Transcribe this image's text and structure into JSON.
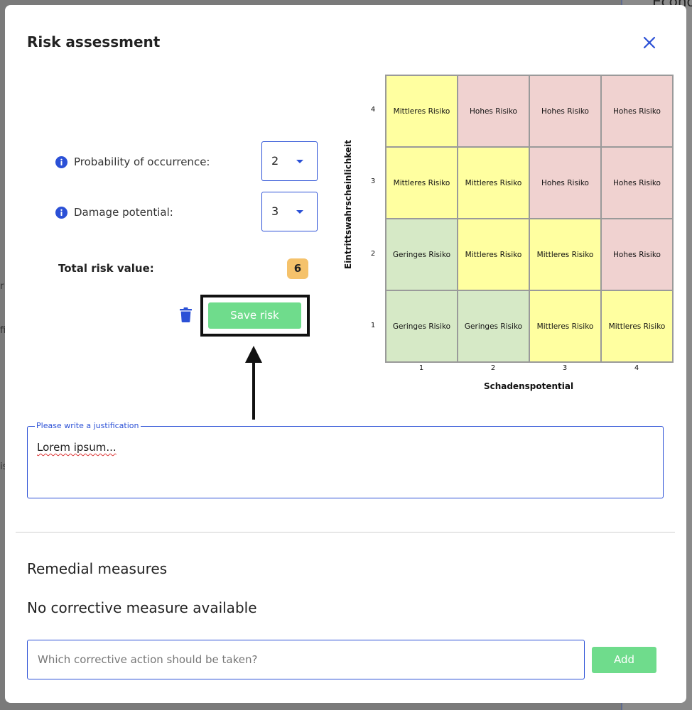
{
  "background": {
    "right_fragment": "Econo",
    "left_fragments": [
      "r",
      "fi",
      "is"
    ]
  },
  "modal": {
    "title": "Risk assessment",
    "close_icon": "close-icon"
  },
  "form": {
    "probability": {
      "label": "Probability of occurrence:",
      "value": "2"
    },
    "damage": {
      "label": "Damage potential:",
      "value": "3"
    },
    "total_label": "Total risk value:",
    "total_value": "6",
    "save_label": "Save risk",
    "delete_icon": "trash-icon"
  },
  "matrix": {
    "y_axis_label": "Eintrittswahrscheinlichkeit",
    "x_axis_label": "Schadenspotential",
    "y_ticks": [
      "4",
      "3",
      "2",
      "1"
    ],
    "x_ticks": [
      "1",
      "2",
      "3",
      "4"
    ],
    "rows": [
      [
        {
          "text": "Mittleres Risiko",
          "level": "yellow"
        },
        {
          "text": "Hohes Risiko",
          "level": "red"
        },
        {
          "text": "Hohes Risiko",
          "level": "red"
        },
        {
          "text": "Hohes Risiko",
          "level": "red"
        }
      ],
      [
        {
          "text": "Mittleres Risiko",
          "level": "yellow"
        },
        {
          "text": "Mittleres Risiko",
          "level": "yellow"
        },
        {
          "text": "Hohes Risiko",
          "level": "red"
        },
        {
          "text": "Hohes Risiko",
          "level": "red"
        }
      ],
      [
        {
          "text": "Geringes Risiko",
          "level": "green"
        },
        {
          "text": "Mittleres Risiko",
          "level": "yellow"
        },
        {
          "text": "Mittleres Risiko",
          "level": "yellow"
        },
        {
          "text": "Hohes Risiko",
          "level": "red"
        }
      ],
      [
        {
          "text": "Geringes Risiko",
          "level": "green"
        },
        {
          "text": "Geringes Risiko",
          "level": "green"
        },
        {
          "text": "Mittleres Risiko",
          "level": "yellow"
        },
        {
          "text": "Mittleres Risiko",
          "level": "yellow"
        }
      ]
    ],
    "colors": {
      "yellow": "#ffffa0",
      "red": "#f0d2d0",
      "green": "#d6e9c6"
    }
  },
  "justification": {
    "legend": "Please write a justification",
    "value": "Lorem ipsum..."
  },
  "remedial": {
    "title": "Remedial measures",
    "empty_text": "No corrective measure available",
    "input_placeholder": "Which corrective action should be taken?",
    "add_label": "Add"
  },
  "colors": {
    "accent": "#2b50d6",
    "button_green": "#6fdc8c",
    "badge": "#f5c26b"
  }
}
